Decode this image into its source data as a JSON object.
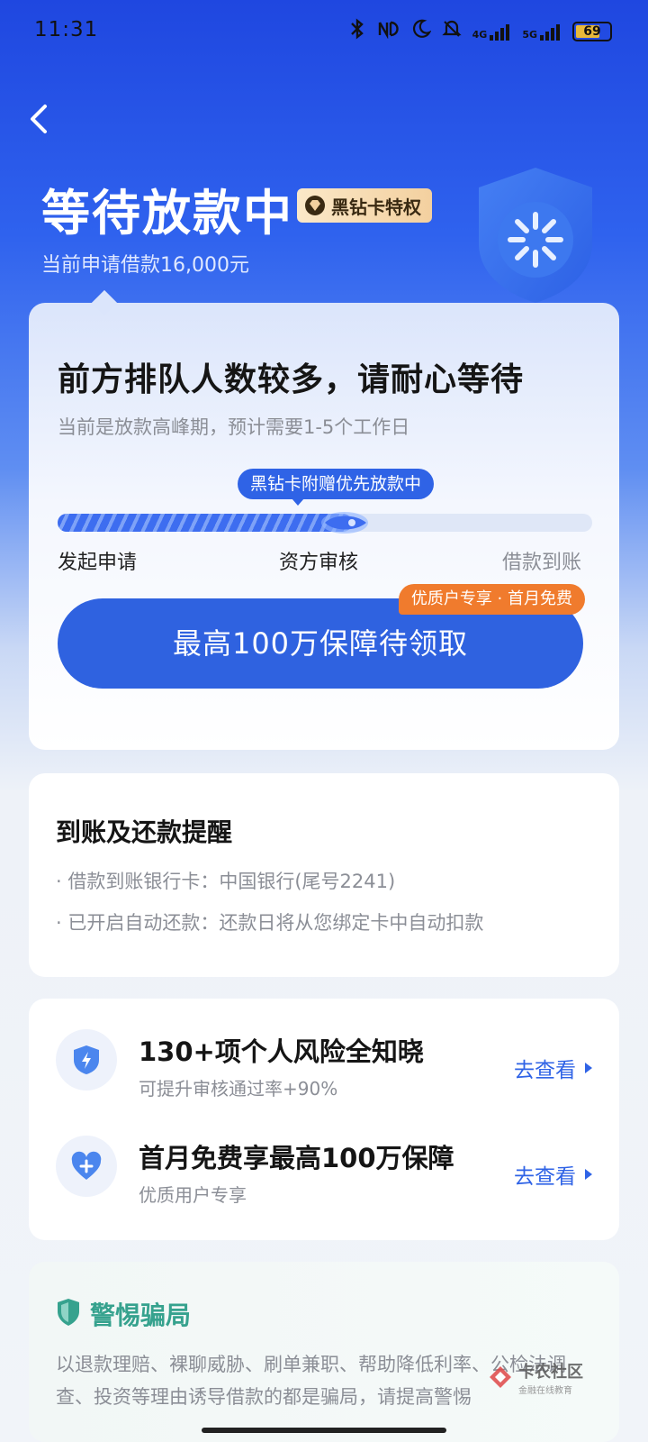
{
  "status_bar": {
    "time": "11:31",
    "battery": "69",
    "signal_4g": "4G",
    "signal_5g": "5G"
  },
  "header": {
    "title": "等待放款中",
    "badge": "黑钻卡特权",
    "subtitle": "当前申请借款16,000元"
  },
  "progress_card": {
    "title": "前方排队人数较多，请耐心等待",
    "subtitle": "当前是放款高峰期，预计需要1-5个工作日",
    "tag": "黑钻卡附赠优先放款中",
    "progress_fraction": 0.55,
    "steps": [
      "发起申请",
      "资方审核",
      "借款到账"
    ],
    "cta_label": "最高100万保障待领取",
    "cta_tag": "优质户专享 · 首月免费"
  },
  "reminder_card": {
    "title": "到账及还款提醒",
    "lines": [
      "· 借款到账银行卡：中国银行(尾号2241)",
      "· 已开启自动还款：还款日将从您绑定卡中自动扣款"
    ]
  },
  "services_card": {
    "items": [
      {
        "title": "130+项个人风险全知晓",
        "sub": "可提升审核通过率+90%",
        "link": "去查看",
        "icon": "shield-bolt-icon"
      },
      {
        "title": "首月免费享最高100万保障",
        "sub": "优质用户专享",
        "link": "去查看",
        "icon": "heart-plus-icon"
      }
    ]
  },
  "warning_card": {
    "title": "警惕骗局",
    "text": "以退款理赔、裸聊威胁、刷单兼职、帮助降低利率、公检法调查、投资等理由诱导借款的都是骗局，请提高警惕"
  },
  "watermark": {
    "main": "卡农社区",
    "sub": "金融在线教育"
  },
  "colors": {
    "primary": "#2f62e0",
    "accent_orange": "#f07b2d",
    "warning_green": "#36a28e"
  }
}
